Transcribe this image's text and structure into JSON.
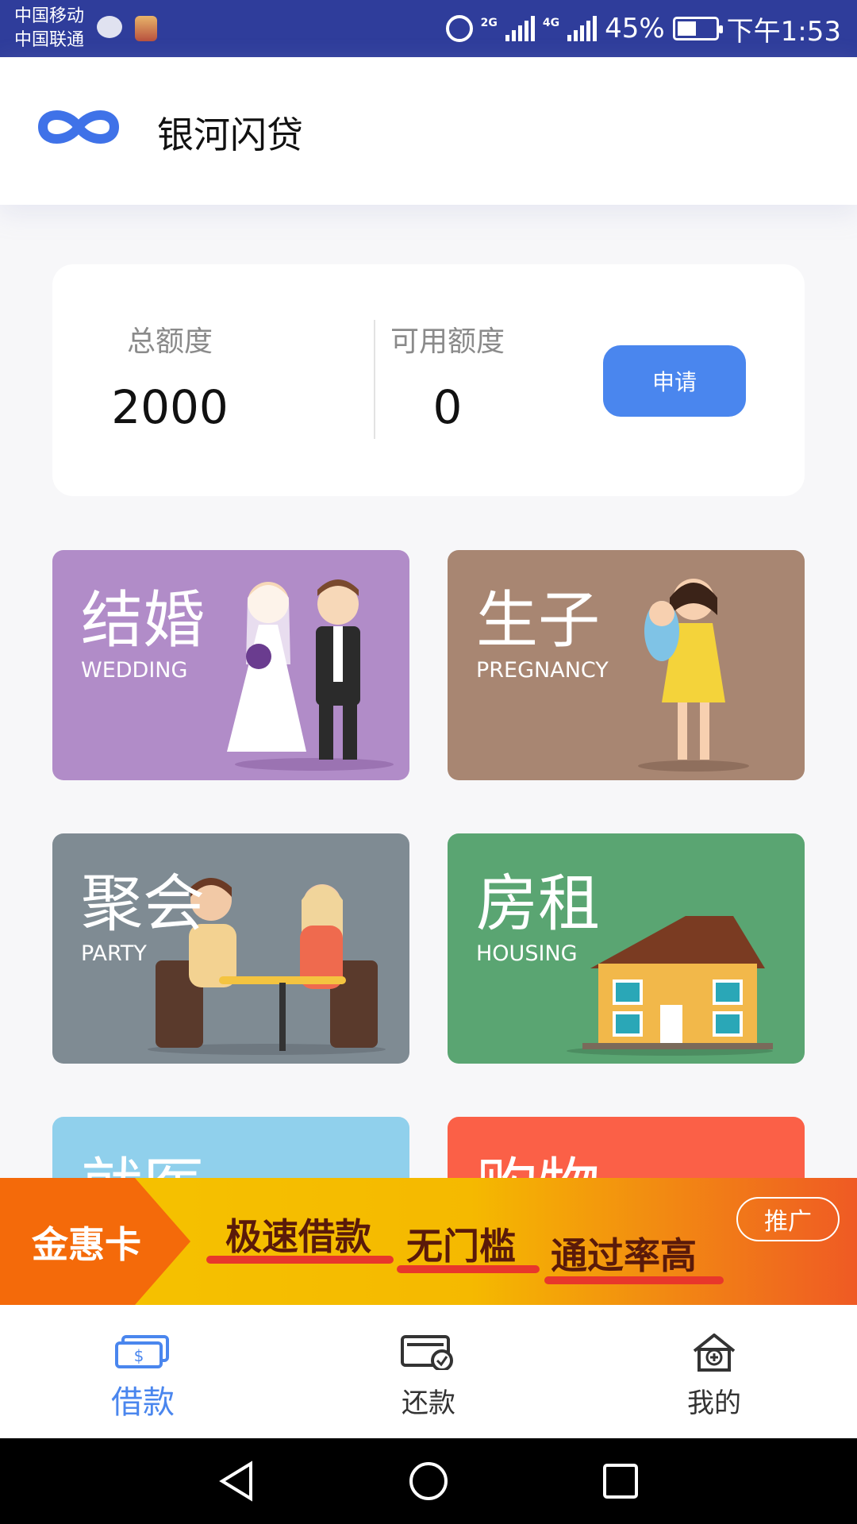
{
  "status_bar": {
    "carrier_1": "中国移动",
    "carrier_2": "中国联通",
    "net_1": "2G",
    "net_2": "4G",
    "battery": "45%",
    "time": "下午1:53"
  },
  "app": {
    "title": "银河闪贷",
    "logo_icon": "infinity-logo-icon"
  },
  "credit": {
    "total_label": "总额度",
    "total_value": "2000",
    "available_label": "可用额度",
    "available_value": "0",
    "apply_label": "申请"
  },
  "categories": [
    {
      "cn": "结婚",
      "en": "WEDDING",
      "color": "#b18cc8"
    },
    {
      "cn": "生子",
      "en": "PREGNANCY",
      "color": "#a88672"
    },
    {
      "cn": "聚会",
      "en": "PARTY",
      "color": "#7f8b93"
    },
    {
      "cn": "房租",
      "en": "HOUSING",
      "color": "#5aa572"
    },
    {
      "cn": "就医",
      "en": "",
      "color": "#90d0ec"
    },
    {
      "cn": "购物",
      "en": "",
      "color": "#fb6047"
    }
  ],
  "banner": {
    "brand": "金惠卡",
    "text_1": "极速借款",
    "text_2": "无门槛",
    "text_3": "通过率高",
    "tag": "推广"
  },
  "bottom_nav": {
    "items": [
      {
        "label": "借款",
        "icon": "cash-icon",
        "active": true
      },
      {
        "label": "还款",
        "icon": "card-check-icon",
        "active": false
      },
      {
        "label": "我的",
        "icon": "home-plus-icon",
        "active": false
      }
    ],
    "active_color": "#4a86ee"
  },
  "colors": {
    "status_bar": "#2f3d9b",
    "primary": "#4a86ee"
  }
}
